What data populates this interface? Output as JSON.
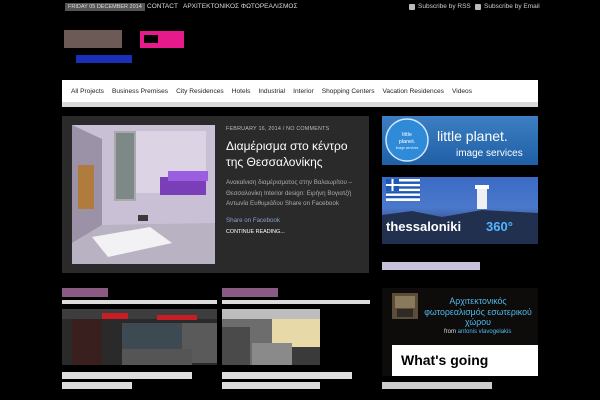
{
  "topbar": {
    "date": "FRIDAY 05 DECEMBER 2014",
    "links": [
      "CONTACT",
      "ΑΡΧΙΤΕΚΤΟΝΙΚΟΣ ΦΩΤΟΡΕΑΛΙΣΜΟΣ"
    ],
    "subscribe_rss": "Subscribe by RSS",
    "subscribe_email": "Subscribe by Email"
  },
  "nav": {
    "items": [
      "All Projects",
      "Business Premises",
      "City Residences",
      "Hotels",
      "Industrial",
      "Interior",
      "Shopping Centers",
      "Vacation Residences",
      "Videos"
    ]
  },
  "featured": {
    "date": "FEBRUARY 16, 2014",
    "comments": "NO COMMENTS",
    "title": "Διαμέρισμα στο κέντρο της Θεσσαλονίκης",
    "excerpt": "Ανακαίνιση διαμέρισματος στην Βαλαωρίτου – Θεσσαλονίκη Interior design: Ειρήνη Βογιατζή Αντωνία Ευθυμιάδου Share on Facebook",
    "share": "Share on Facebook",
    "more": "CONTINUE READING..."
  },
  "sidebar": {
    "banner1_title": "little planet.",
    "banner1_subtitle": "image services",
    "banner1_badge_line1": "little",
    "banner1_badge_line2": "planet.",
    "banner1_badge_line3": "image services",
    "banner2_title": "thessaloniki",
    "banner2_suffix": "360°",
    "promo_title": "Αρχιτεκτονικός φωτορεαλισμός εσωτερικού χώρου",
    "promo_by_prefix": "from",
    "promo_by_name": "antonis vlavogelakis",
    "promo_text": "What's going"
  },
  "colors": {
    "accent_pink": "#e61a8a",
    "section_label": "#8a5a85",
    "link_blue": "#8a9ecf"
  }
}
